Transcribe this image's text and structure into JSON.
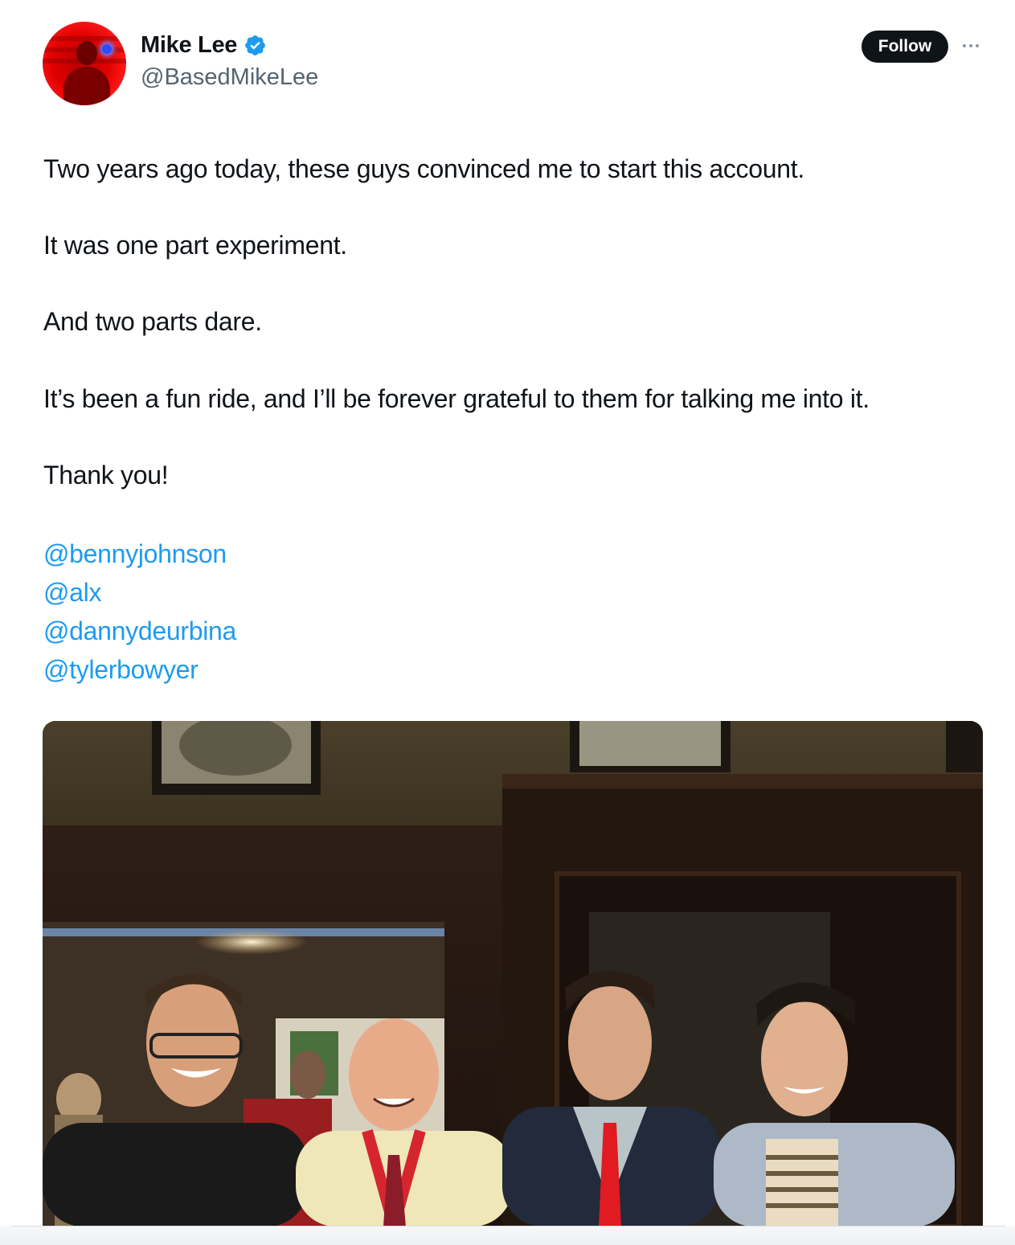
{
  "tweet": {
    "author": {
      "display_name": "Mike Lee",
      "handle": "@BasedMikeLee",
      "verified": true,
      "verified_color": "#1d9bf0",
      "avatar_tint": "#e10000"
    },
    "follow_label": "Follow",
    "paragraphs": [
      "Two years ago today, these guys convinced me to start this account.",
      "It was one part experiment.",
      "And two parts dare.",
      "It’s been a fun ride, and I’ll be forever grateful to them for talking me into it.",
      "Thank you!"
    ],
    "mentions": [
      "@bennyjohnson",
      "@alx",
      "@dannydeurbina",
      "@tylerbowyer"
    ],
    "mention_color": "#1d9bf0"
  }
}
